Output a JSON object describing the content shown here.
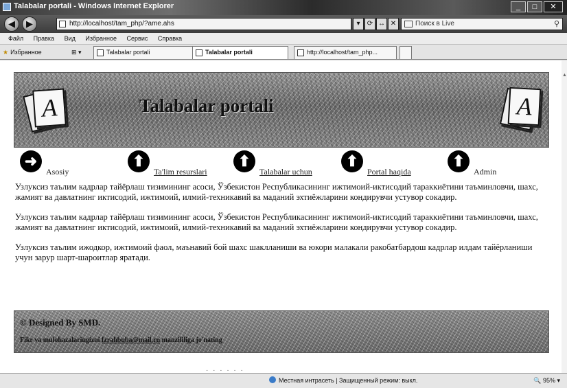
{
  "window": {
    "title": "Talabalar portali - Windows Internet Explorer"
  },
  "address_bar": {
    "url": "http://localhost/tam_php/?ame.ahs",
    "buttons": [
      "▾",
      "⟳",
      "↔",
      "✕"
    ]
  },
  "search": {
    "placeholder": "Поиск в Live"
  },
  "menu": [
    "Файл",
    "Правка",
    "Вид",
    "Избранное",
    "Сервис",
    "Справка"
  ],
  "favorites": {
    "label": "Избранное",
    "grid_label": "▾"
  },
  "tabs": [
    {
      "label": "Talabalar portali"
    },
    {
      "label": "Talabalar portali"
    },
    {
      "label": "http://localhost/tam_php..."
    }
  ],
  "banner": {
    "title": "Talabalar portali",
    "card_letter": "A"
  },
  "nav": [
    {
      "label": "Asosiy",
      "icon": "arrow-right-icon"
    },
    {
      "label": "Ta'lim resurslari",
      "icon": "arrow-up-icon"
    },
    {
      "label": "Talabalar uchun",
      "icon": "arrow-up-icon"
    },
    {
      "label": "Portal haqida",
      "icon": "arrow-up-icon"
    },
    {
      "label": "Admin",
      "icon": "arrow-up-icon"
    }
  ],
  "content": {
    "p1": "Узлуксиз таълим кадрлар тайёрлаш тизимининг асоси, Ўзбекистон Республикасининг ижтимоий-иктисодий тараккиётини таъминловчи, шахс, жамият ва давлатнинг иктисодий, ижтимоий, илмий-техникавий ва маданий эхтиёжларини кондирувчи устувор сокадир.",
    "p2": "Узлуксиз таълим кадрлар тайёрлаш тизимининг асоси, Ўзбекистон Республикасининг ижтимоий-иктисодий тараккиётини таъминловчи, шахс, жамият ва давлатнинг иктисодий, ижтимоий, илмий-техникавий ва маданий эхтиёжларини кондирувчи устувор сокадир.",
    "p3": "Узлуксиз таълим ижодкор, ижтимоий фаол, маънавий бой шахс шаклланиши ва юкори малакали ракобатбардош кадрлар илдам тайёрланиши учун зарур шарт-шароитлар яратади."
  },
  "footer": {
    "designed": "© Designed By SMD.",
    "feedback_prefix": "Fikr va mulohazalaringizni ",
    "feedback_email": "fzrahbuba@mail.ru",
    "feedback_suffix": " manzililiga jo'nating"
  },
  "status": {
    "zone": "Местная интрасеть | Защищенный режим: выкл.",
    "zoom": "95%",
    "zoom_icon": "zoom-icon"
  },
  "colors": {
    "nav_circle": "#000000",
    "page_bg": "#ffffff",
    "chrome_dark": "#3c3c3c"
  }
}
